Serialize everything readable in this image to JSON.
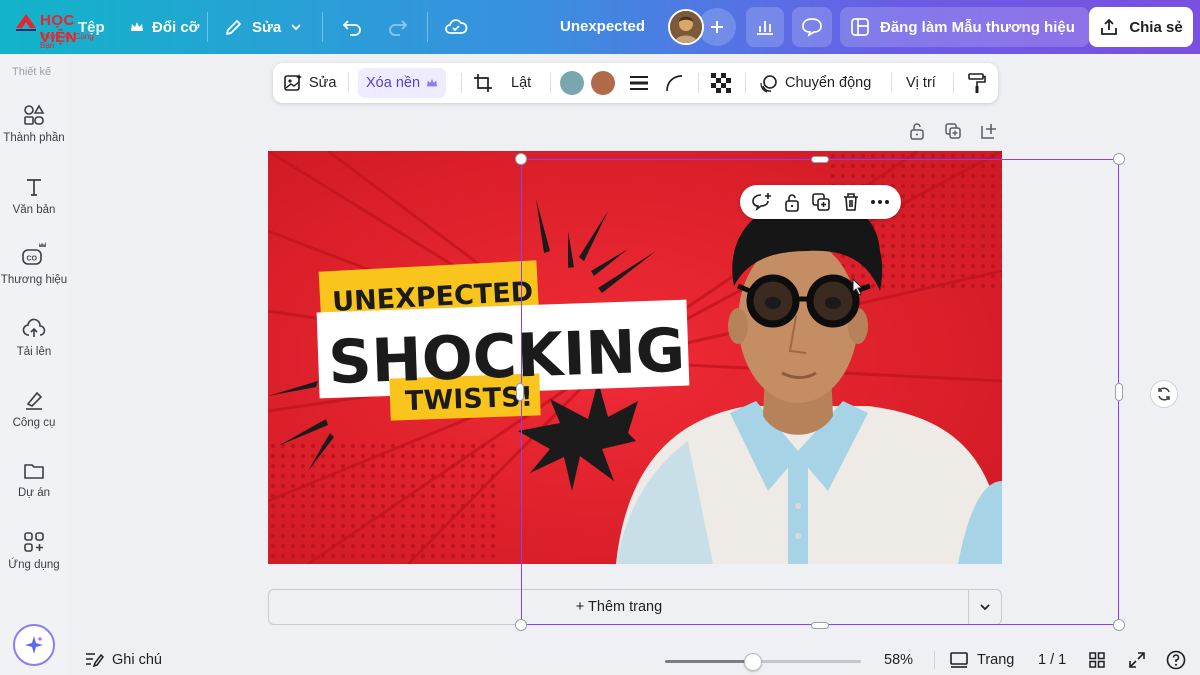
{
  "logo": {
    "name": "HỌC VIỆN",
    "tagline": "Vươn Xa Cùng Bạn"
  },
  "topbar": {
    "menu_label": "Tệp",
    "resize_label": "Đổi cỡ",
    "edit_label": "Sửa",
    "doc_title": "Unexpected",
    "brand_template_label": "Đăng làm Mẫu thương hiệu",
    "share_label": "Chia sẻ"
  },
  "sidebar": {
    "cut_label": "Thiết kế",
    "items": [
      {
        "label": "Thành phần",
        "icon": "elements-icon"
      },
      {
        "label": "Văn bản",
        "icon": "text-icon"
      },
      {
        "label": "Thương hiệu",
        "icon": "brand-icon"
      },
      {
        "label": "Tải lên",
        "icon": "upload-icon"
      },
      {
        "label": "Công cụ",
        "icon": "tools-icon"
      },
      {
        "label": "Dự án",
        "icon": "folder-icon"
      },
      {
        "label": "Ứng dụng",
        "icon": "apps-icon"
      }
    ]
  },
  "context_toolbar": {
    "edit_label": "Sửa",
    "bg_remove_label": "Xóa nền",
    "flip_label": "Lật",
    "animate_label": "Chuyển động",
    "position_label": "Vị trí",
    "swatch_colors": [
      "#7aa6b0",
      "#b06a48"
    ]
  },
  "design": {
    "line1": "UNEXPECTED",
    "line2": "SHOCKING",
    "line3": "TWISTS!",
    "colors": {
      "bg": "#e8222d",
      "yellow": "#f9c41b",
      "white": "#ffffff",
      "dark": "#1b1b1b"
    }
  },
  "add_page_label": "+ Thêm trang",
  "bottom": {
    "notes_label": "Ghi chú",
    "zoom": "58%",
    "zoom_value": 0.45,
    "pages_label": "Trang",
    "page_count": "1 / 1"
  },
  "colors": {
    "accent": "#8b3dff",
    "topbar_start": "#12b4c9",
    "topbar_end": "#7b4fe0"
  }
}
